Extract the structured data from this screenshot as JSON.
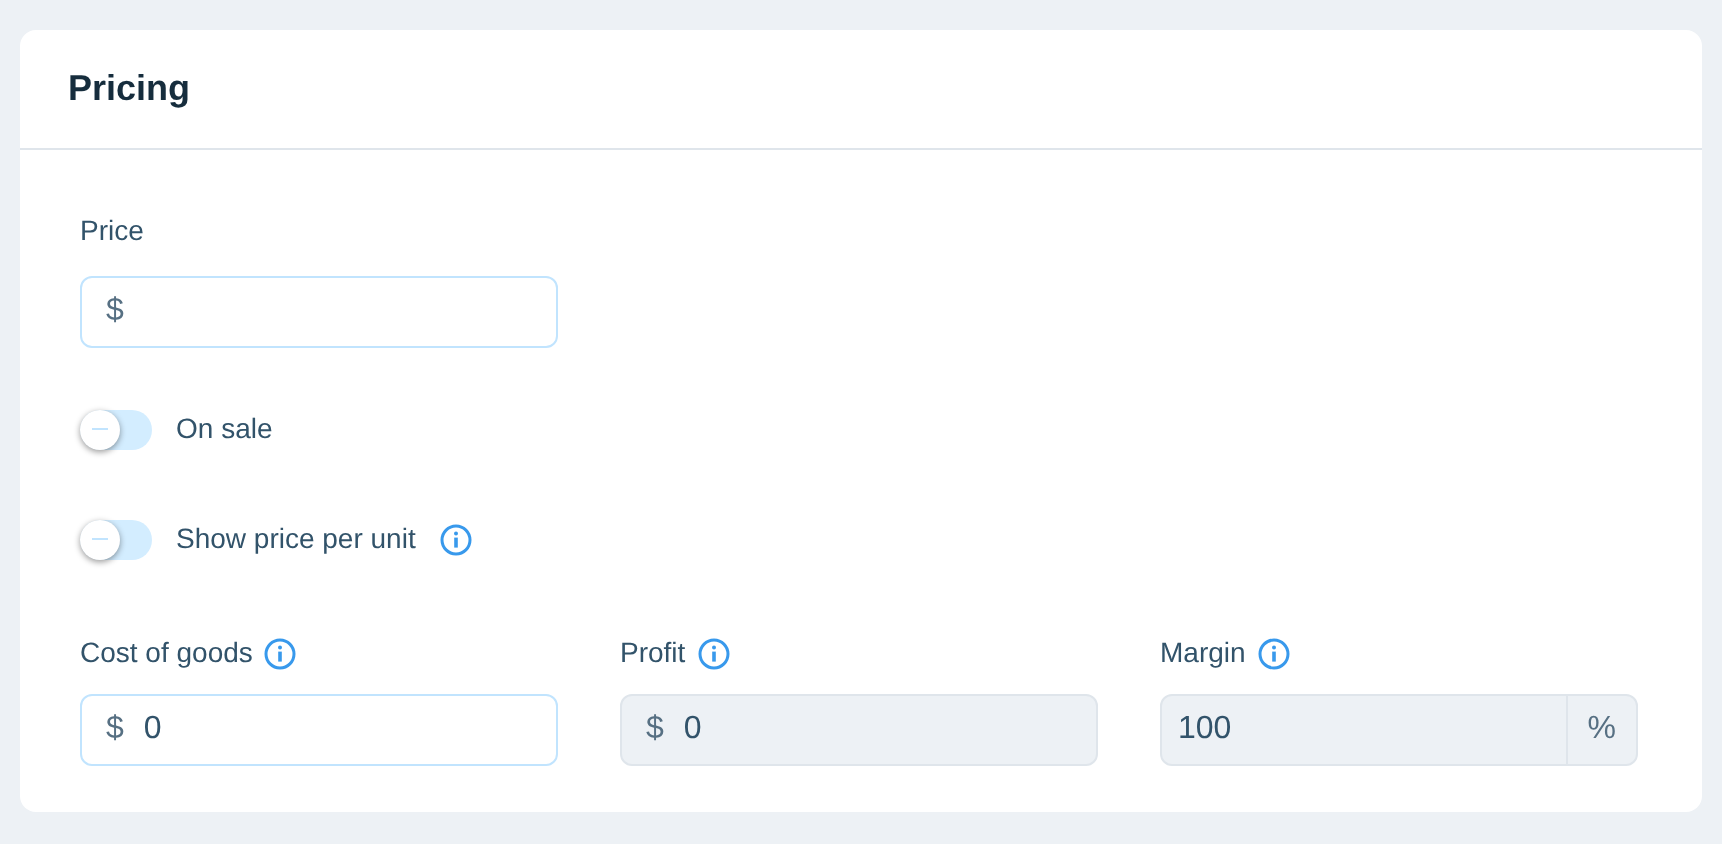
{
  "card": {
    "title": "Pricing"
  },
  "price": {
    "label": "Price",
    "prefix": "$",
    "disabled": false
  },
  "toggles": [
    {
      "label": "On sale",
      "on": false,
      "info": false
    },
    {
      "label": "Show price per unit",
      "on": false,
      "info": true
    }
  ],
  "fields": [
    {
      "label": "Cost of goods",
      "prefix": "$",
      "value": "0",
      "disabled": false
    },
    {
      "label": "Profit",
      "prefix": "$",
      "value": "0",
      "disabled": true
    },
    {
      "label": "Margin",
      "value": "100",
      "suffix": "%",
      "disabled": true
    }
  ]
}
